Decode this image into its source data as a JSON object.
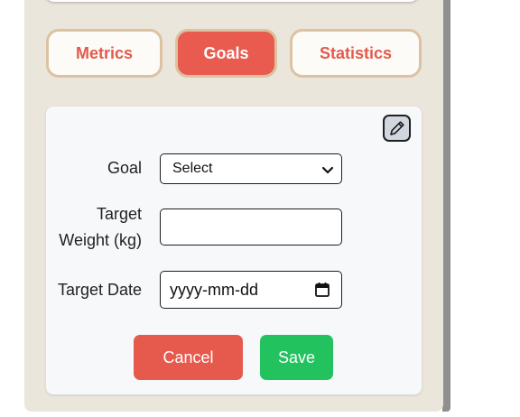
{
  "tabs": [
    {
      "label": "Metrics",
      "active": false
    },
    {
      "label": "Goals",
      "active": true
    },
    {
      "label": "Statistics",
      "active": false
    }
  ],
  "edit_icon": "pencil-icon",
  "form": {
    "goal_label": "Goal",
    "goal_value": "Select",
    "target_weight_label_line1": "Target",
    "target_weight_label_line2": "Weight (kg)",
    "target_weight_value": "",
    "target_date_label": "Target Date",
    "target_date_placeholder": "yyyy-mm-dd"
  },
  "buttons": {
    "cancel": "Cancel",
    "save": "Save"
  },
  "colors": {
    "panel_bg": "#ebe6db",
    "tab_border": "#dcc2a1",
    "tab_text": "#e35a4b",
    "tab_active_bg": "#e85b4e",
    "cancel_bg": "#e65a4d",
    "save_bg": "#22c25e",
    "card_bg": "#f7f8fa"
  }
}
